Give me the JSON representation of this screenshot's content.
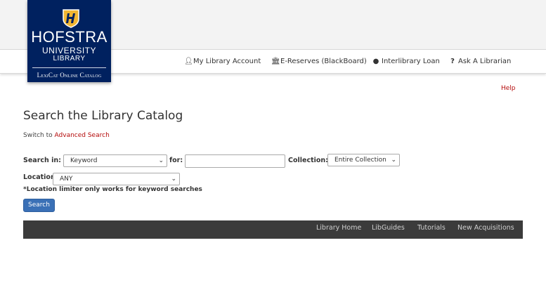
{
  "logo": {
    "name": "HOFSTRA",
    "university": "UNIVERSITY",
    "library": "LIBRARY",
    "subtitle": "LexiCat Online Catalog",
    "colors": {
      "background": "#00215f",
      "shield": "#f2b632"
    }
  },
  "nav": {
    "items": [
      {
        "label": "My Library Account",
        "icon": "user-icon"
      },
      {
        "label": "E-Reserves (BlackBoard)",
        "icon": "bank-icon"
      },
      {
        "label": "Interlibrary Loan",
        "icon": "globe-icon"
      },
      {
        "label": "Ask A Librarian",
        "icon": "question-icon"
      }
    ]
  },
  "help_link": "Help",
  "page": {
    "title": "Search the Library Catalog",
    "switch_prefix": "Switch to",
    "switch_link": "Advanced Search"
  },
  "search": {
    "search_in_label": "Search in:",
    "search_in_value": "Keyword",
    "for_label": "for:",
    "query_value": "",
    "collection_label": "Collection:",
    "collection_value": "Entire Collection",
    "location_label": "Location:",
    "location_value": "ANY",
    "note": "*Location limiter only works for keyword searches",
    "button": "Search"
  },
  "footer": {
    "links": [
      "Library Home",
      "LibGuides",
      "Tutorials",
      "New Acquisitions"
    ]
  },
  "colors": {
    "link_red": "#b40a0a",
    "button_blue": "#3a70b6",
    "footer_bg": "#3b3b3b"
  }
}
